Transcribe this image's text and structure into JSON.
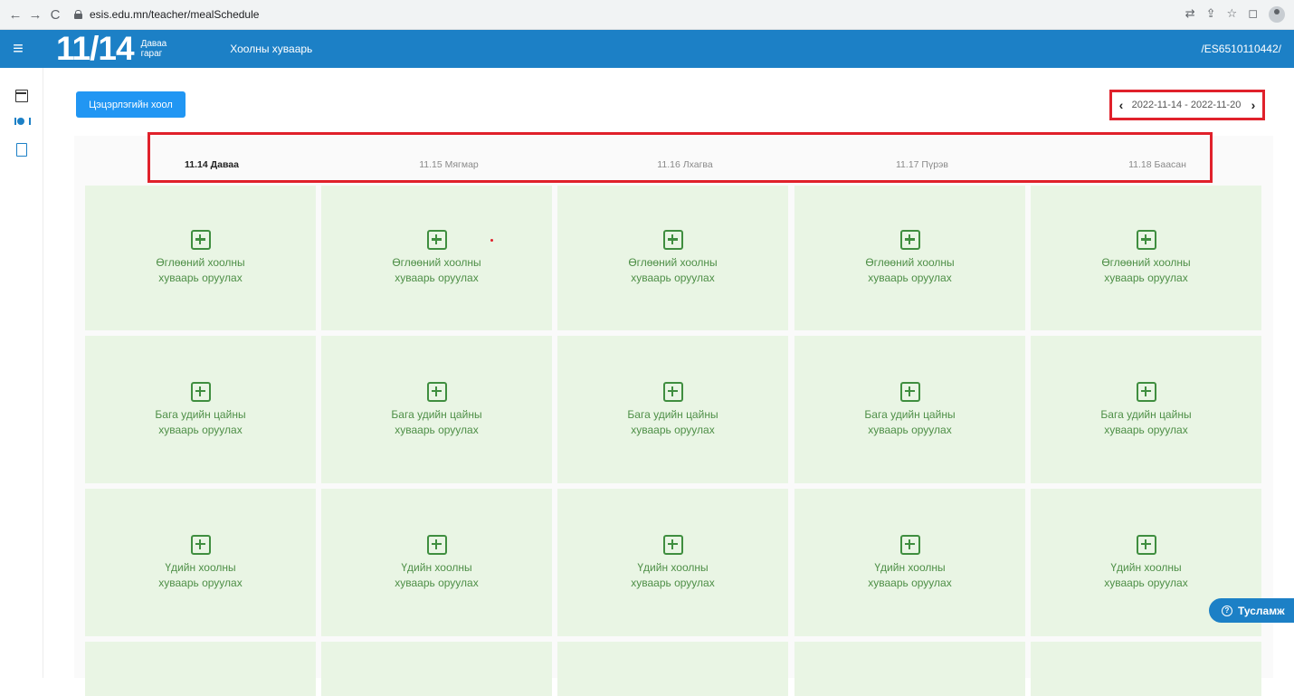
{
  "browser": {
    "url": "esis.edu.mn/teacher/mealSchedule"
  },
  "header": {
    "date": "11/14",
    "weekday_line1": "Даваа",
    "weekday_line2": "гараг",
    "title": "Хоолны хуваарь",
    "user": "/ES6510110442/"
  },
  "toolbar": {
    "kindergarten_meal_label": "Цэцэрлэгийн хоол",
    "date_range": "2022-11-14 - 2022-11-20"
  },
  "days": [
    {
      "label": "11.14 Даваа",
      "active": true
    },
    {
      "label": "11.15 Мягмар",
      "active": false
    },
    {
      "label": "11.16 Лхагва",
      "active": false
    },
    {
      "label": "11.17 Пүрэв",
      "active": false
    },
    {
      "label": "11.18 Баасан",
      "active": false
    }
  ],
  "meal_rows": [
    {
      "line1": "Өглөөний хоолны",
      "line2": "хуваарь оруулах"
    },
    {
      "line1": "Бага удийн цайны",
      "line2": "хуваарь оруулах"
    },
    {
      "line1": "Үдийн хоолны",
      "line2": "хуваарь оруулах"
    },
    {
      "line1": "",
      "line2": ""
    }
  ],
  "help": {
    "label": "Тусламж"
  },
  "colors": {
    "primary": "#1c80c6",
    "button": "#2196f3",
    "cell_bg": "#e9f5e4",
    "cell_text": "#4e8f47",
    "highlight": "#e0212b"
  }
}
